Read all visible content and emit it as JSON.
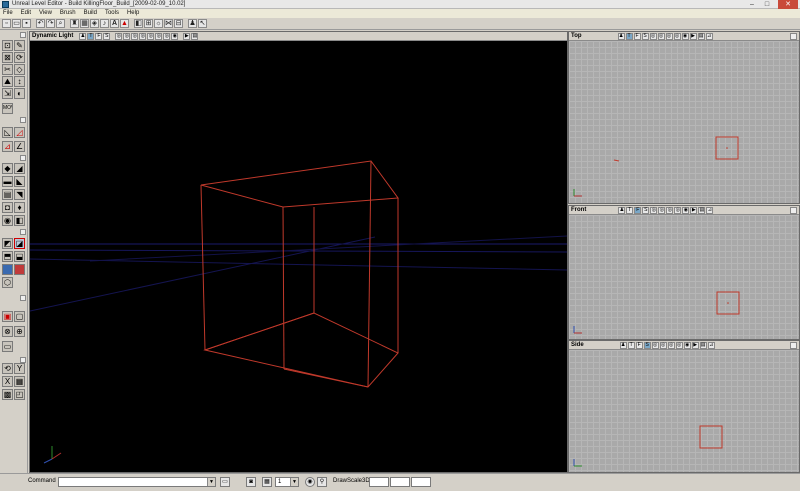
{
  "window": {
    "title": "Unreal Level Editor - Build KillingFloor_Build_[2009-02-09_10.02]",
    "buttons": {
      "minimize": "–",
      "maximize": "□",
      "close": "✕"
    }
  },
  "menu": [
    "File",
    "Edit",
    "View",
    "Brush",
    "Build",
    "Tools",
    "Help"
  ],
  "toolbar": {
    "icons": [
      "new-icon",
      "open-icon",
      "save-icon",
      "undo-icon",
      "redo-icon",
      "search-icon",
      "actor-browser-icon",
      "texture-browser-icon",
      "mesh-browser-icon",
      "sound-browser-icon",
      "font-icon",
      "actor-class-icon",
      "2d-shape-icon",
      "build-geometry-icon",
      "build-lighting-icon",
      "build-paths-icon",
      "build-all-icon",
      "play-icon",
      "pointer-icon"
    ],
    "text_glyph": "A"
  },
  "viewports": {
    "perspective": {
      "title": "Dynamic Light"
    },
    "top": {
      "title": "Top"
    },
    "front": {
      "title": "Front"
    },
    "side": {
      "title": "Side"
    }
  },
  "left_panel": {
    "mover_label": "MOVER"
  },
  "statusbar": {
    "command_label": "Command",
    "command_value": "",
    "drawscale_label": "DrawScale3D:",
    "snap_value": "1",
    "drawscale_values": [
      "",
      "",
      ""
    ]
  },
  "colors": {
    "brush": "#c0392b",
    "perspective_bg": "#000000",
    "ortho_grid_bg": "#a9a9a9",
    "ground_line": "#1a1a6a"
  }
}
